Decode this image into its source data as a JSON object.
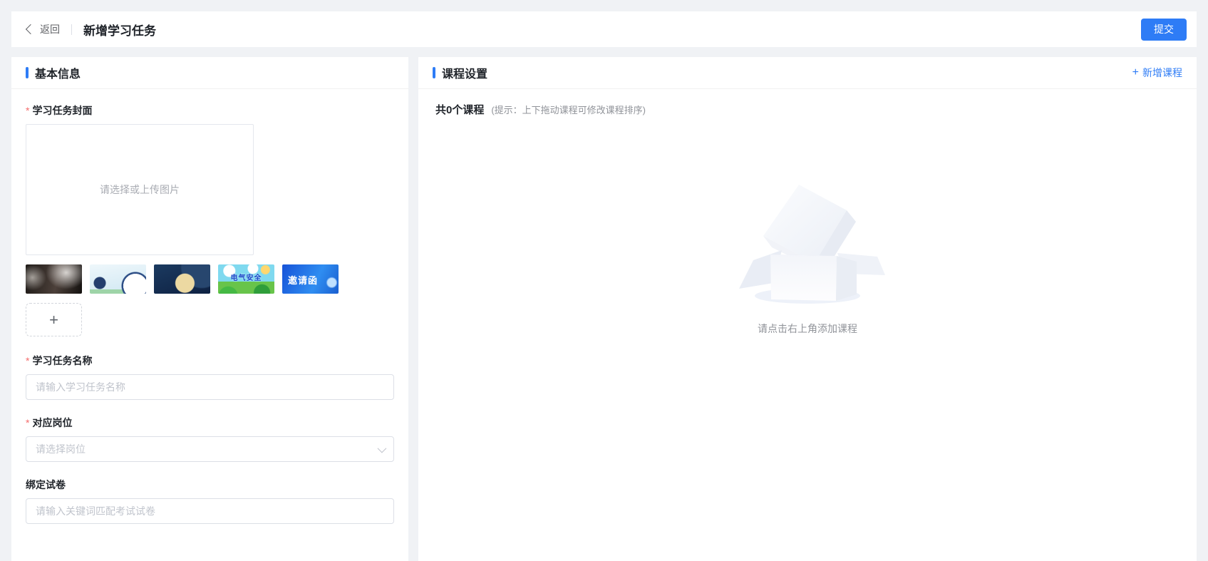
{
  "colors": {
    "primary": "#2E7CF6",
    "danger": "#F56C6C",
    "page_background": "#F0F2F5"
  },
  "topbar": {
    "back_label": "返回",
    "title": "新增学习任务",
    "submit_label": "提交"
  },
  "basic_info": {
    "section_title": "基本信息",
    "required_marker": "*",
    "cover_label": "学习任务封面",
    "cover_placeholder": "请选择或上传图片",
    "thumbnails": [
      {
        "name": "dark-room-photo",
        "text": ""
      },
      {
        "name": "blue-crescent-training-banner",
        "text": ""
      },
      {
        "name": "navy-moon-banner",
        "text": ""
      },
      {
        "name": "green-cartoon-banner",
        "text": "电气安全"
      },
      {
        "name": "blue-invitation-banner",
        "text": "邀请函"
      }
    ],
    "add_cover_icon": "+",
    "name_label": "学习任务名称",
    "name_placeholder": "请输入学习任务名称",
    "position_label": "对应岗位",
    "position_placeholder": "请选择岗位",
    "paper_label": "绑定试卷",
    "paper_placeholder": "请输入关键词匹配考试试卷"
  },
  "course_settings": {
    "section_title": "课程设置",
    "add_icon": "+",
    "add_course_label": "新增课程",
    "count_text": "共0个课程",
    "hint_text": "(提示：上下拖动课程可修改课程排序)",
    "empty_text": "请点击右上角添加课程"
  }
}
